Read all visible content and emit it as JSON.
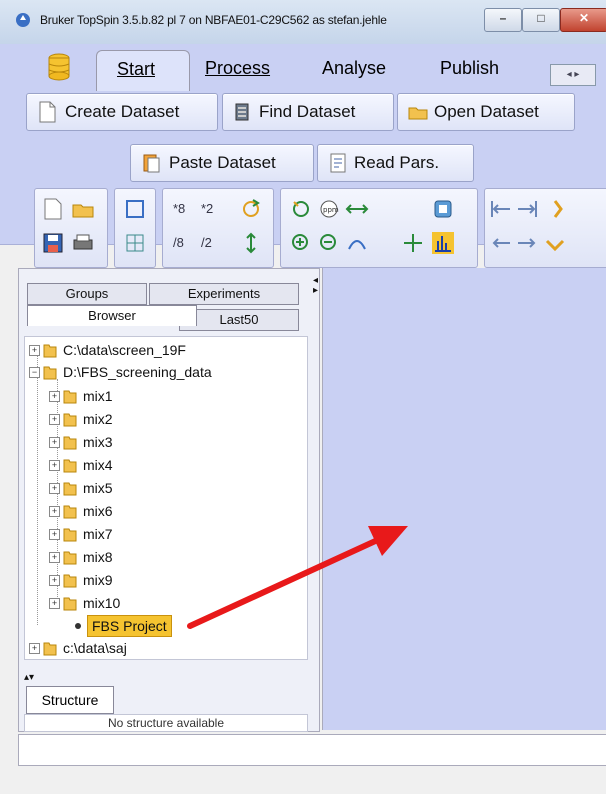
{
  "window": {
    "title": "Bruker TopSpin 3.5.b.82 pl 7 on NBFAE01-C29C562 as stefan.jehle",
    "controls": {
      "minimize": "–",
      "maximize": "□",
      "close": "✕"
    }
  },
  "ribbon": {
    "tabs": [
      {
        "label": "Start",
        "active": true
      },
      {
        "label": "Process"
      },
      {
        "label": "Analyse"
      },
      {
        "label": "Publish"
      }
    ],
    "tab_scroll": "◂ ▸",
    "buttons": {
      "create": "Create Dataset",
      "find": "Find Dataset",
      "open": "Open Dataset",
      "paste": "Paste Dataset",
      "readpars": "Read Pars."
    },
    "toolbar_labels": [
      "*8",
      "*2",
      "/8",
      "/2"
    ]
  },
  "left_panel": {
    "tabs": {
      "groups": "Groups",
      "experiments": "Experiments",
      "browser": "Browser",
      "last50": "Last50"
    },
    "tree": [
      {
        "label": "C:\\data\\screen_19F",
        "level": 0
      },
      {
        "label": "D:\\FBS_screening_data",
        "level": 0
      },
      {
        "label": "mix1",
        "level": 1
      },
      {
        "label": "mix2",
        "level": 1
      },
      {
        "label": "mix3",
        "level": 1
      },
      {
        "label": "mix4",
        "level": 1
      },
      {
        "label": "mix5",
        "level": 1
      },
      {
        "label": "mix6",
        "level": 1
      },
      {
        "label": "mix7",
        "level": 1
      },
      {
        "label": "mix8",
        "level": 1
      },
      {
        "label": "mix9",
        "level": 1
      },
      {
        "label": "mix10",
        "level": 1
      },
      {
        "label": "FBS Project",
        "level": 1,
        "selected": true
      },
      {
        "label": "c:\\data\\saj",
        "level": 0
      }
    ],
    "structure_tab": "Structure",
    "structure_msg": "No structure available"
  },
  "colors": {
    "ribbon_bg": "#c9d0f3",
    "selected_highlight": "#f5c330",
    "annotation_arrow": "#e8191a"
  },
  "icons": [
    "app-icon",
    "database-icon",
    "new-document-icon",
    "find-icon",
    "open-folder-icon",
    "paste-icon",
    "read-pars-icon",
    "folder-icon"
  ]
}
